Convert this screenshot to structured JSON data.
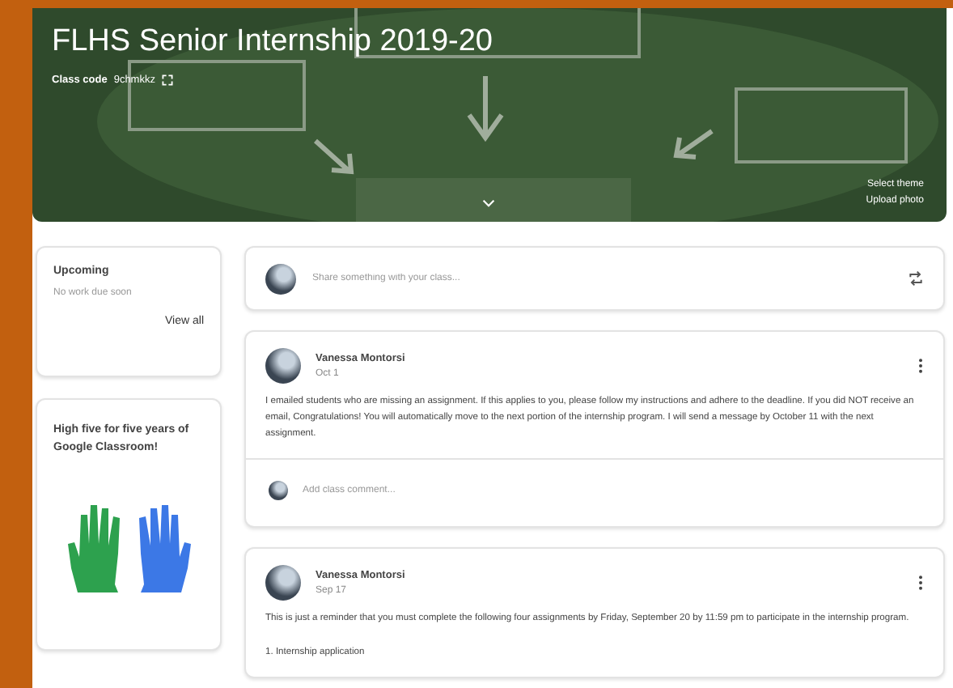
{
  "class": {
    "title": "FLHS Senior Internship 2019-20",
    "class_code_label": "Class code",
    "class_code": "9chmkkz",
    "theme_links": [
      "Select theme",
      "Upload photo"
    ]
  },
  "upcoming": {
    "title": "Upcoming",
    "message": "No work due soon",
    "link": "View all"
  },
  "promo": {
    "text": "High five for five years of Google Classroom!"
  },
  "share": {
    "placeholder": "Share something with your class..."
  },
  "posts": [
    {
      "author": "Vanessa Montorsi",
      "date": "Oct 1",
      "paragraphs": [
        "I emailed students who are missing an assignment. If this applies to you, please follow my instructions and adhere to the deadline. If you did NOT receive an email, Congratulations! You will automatically move to the next portion of the internship program. I will send a message by October 11 with the next assignment."
      ],
      "comment_placeholder": "Add class comment..."
    },
    {
      "author": "Vanessa Montorsi",
      "date": "Sep 17",
      "paragraphs": [
        "This is just a reminder that you must complete the following four assignments by Friday, September 20 by 11:59 pm to participate in the internship program.",
        "1. Internship application"
      ]
    }
  ]
}
